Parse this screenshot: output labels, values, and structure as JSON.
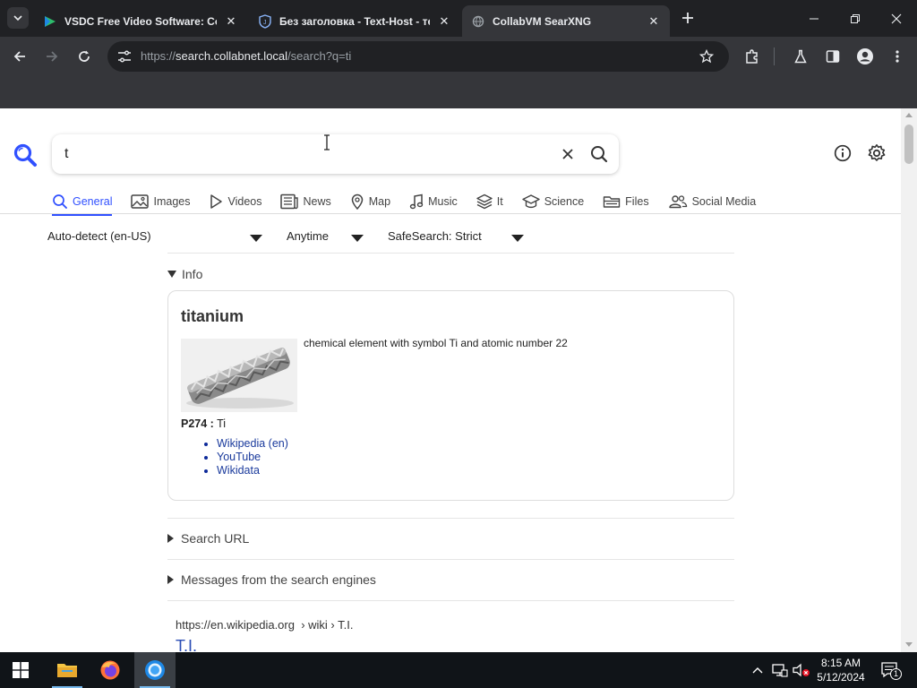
{
  "browser": {
    "tabs": [
      {
        "title": "VSDC Free Video Software: Co",
        "active": false
      },
      {
        "title": "Без заголовка - Text-Host - те",
        "active": false
      },
      {
        "title": "CollabVM SearXNG",
        "active": true
      }
    ],
    "url": {
      "scheme": "https://",
      "host": "search.collabnet.local",
      "path": "/search?q=ti"
    }
  },
  "search": {
    "query": "t",
    "categories": [
      {
        "label": "General",
        "icon": "search-icon",
        "active": true
      },
      {
        "label": "Images",
        "icon": "image-icon"
      },
      {
        "label": "Videos",
        "icon": "play-icon"
      },
      {
        "label": "News",
        "icon": "newspaper-icon"
      },
      {
        "label": "Map",
        "icon": "map-pin-icon"
      },
      {
        "label": "Music",
        "icon": "music-note-icon"
      },
      {
        "label": "It",
        "icon": "layers-icon"
      },
      {
        "label": "Science",
        "icon": "graduation-cap-icon"
      },
      {
        "label": "Files",
        "icon": "folder-icon"
      },
      {
        "label": "Social Media",
        "icon": "people-icon"
      }
    ],
    "filters": {
      "language": "Auto-detect (en-US)",
      "time": "Anytime",
      "safesearch": "SafeSearch: Strict"
    }
  },
  "infobox": {
    "section_label": "Info",
    "title": "titanium",
    "description": "chemical element with symbol Ti and atomic number 22",
    "attribute_name": "P274 :",
    "attribute_value": "Ti",
    "links": [
      "Wikipedia (en)",
      "YouTube",
      "Wikidata"
    ]
  },
  "sections": {
    "search_url": "Search URL",
    "engine_messages": "Messages from the search engines"
  },
  "first_result": {
    "url": "https://en.wikipedia.org",
    "breadcrumb": "› wiki › T.I.",
    "title": "T.I."
  },
  "taskbar": {
    "time": "8:15 AM",
    "date": "5/12/2024",
    "notification_count": "1"
  },
  "colors": {
    "accent": "#3050ff",
    "chrome_dark": "#202124",
    "chrome_toolbar": "#35363a",
    "link": "#1a3a9c"
  }
}
